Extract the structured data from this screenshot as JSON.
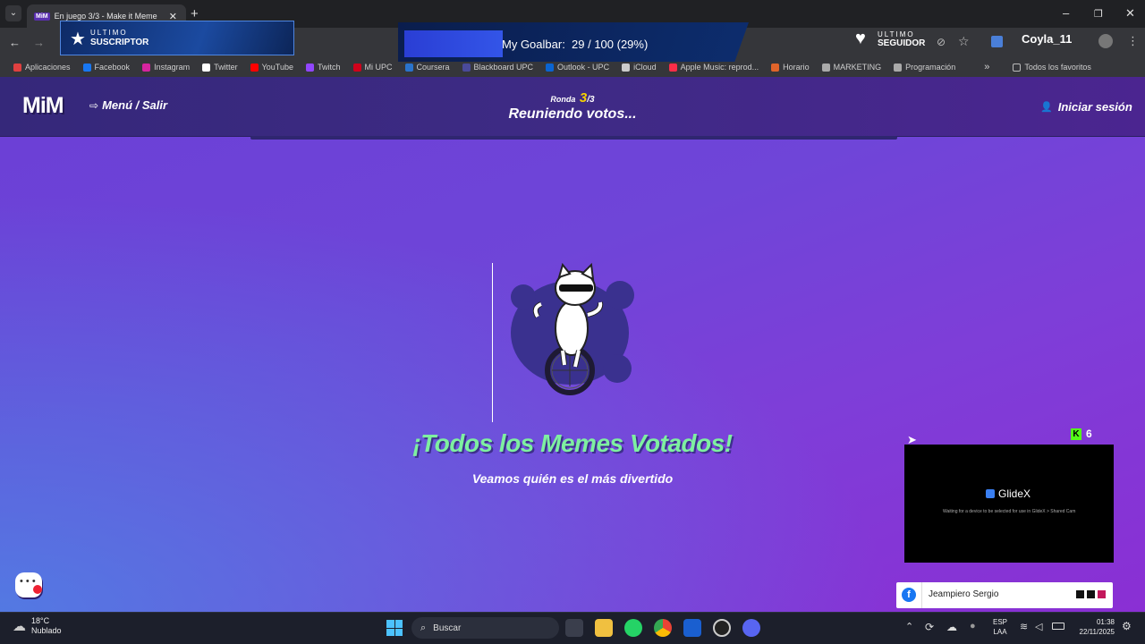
{
  "browser": {
    "tab_title": "En juego 3/3 - Make it Meme",
    "tab_favicon": "MiM",
    "bookmarks": [
      {
        "label": "Aplicaciones",
        "color": "#e04040"
      },
      {
        "label": "Facebook",
        "color": "#1877f2"
      },
      {
        "label": "Instagram",
        "color": "#d6249f"
      },
      {
        "label": "Twitter",
        "color": "#ffffff"
      },
      {
        "label": "YouTube",
        "color": "#ff0000"
      },
      {
        "label": "Twitch",
        "color": "#9146ff"
      },
      {
        "label": "Mi UPC",
        "color": "#d0021b"
      },
      {
        "label": "Coursera",
        "color": "#2a73cc"
      },
      {
        "label": "Blackboard UPC",
        "color": "#4a4a9a"
      },
      {
        "label": "Outlook - UPC",
        "color": "#0a64d2"
      },
      {
        "label": "iCloud",
        "color": "#cccccc"
      },
      {
        "label": "Apple Music: reprod...",
        "color": "#fa2d48"
      },
      {
        "label": "Horario",
        "color": "#e0642a"
      },
      {
        "label": "MARKETING",
        "color": "#aaaaaa"
      },
      {
        "label": "Programación",
        "color": "#aaaaaa"
      }
    ],
    "bookmarks_more": "»",
    "all_favorites": "Todos los favoritos"
  },
  "stream_overlay": {
    "sub_top": "ULTIMO",
    "sub_bottom": "SUSCRIPTOR",
    "goal_text": "My Goalbar:  29 / 100 (29%)",
    "goal_progress": 0.29,
    "follower_top": "ULTIMO",
    "follower_bottom": "SEGUIDOR",
    "follower_name": "Coyla_11"
  },
  "game": {
    "logo": "MiM",
    "menu_label": "Menú / Salir",
    "round_label": "Ronda",
    "round_current": "3",
    "round_total": "/3",
    "status": "Reuniendo votos...",
    "login_label": "Iniciar sesión",
    "headline": "¡Todos los Memes Votados!",
    "subline": "Veamos quién es el más divertido"
  },
  "glidex": {
    "counter": "6",
    "title": "GlideX",
    "message": "Waiting for a device to be selected for use in GlideX > Shared Cam",
    "fb_name": "Jeampiero Sergio"
  },
  "taskbar": {
    "weather_temp": "18°C",
    "weather_desc": "Nublado",
    "search_placeholder": "Buscar",
    "lang_top": "ESP",
    "lang_bottom": "LAA",
    "time": "01:38",
    "date": "22/11/2025"
  },
  "colors": {
    "headline_green": "#7ef0a0",
    "accent_yellow": "#f5d000"
  }
}
